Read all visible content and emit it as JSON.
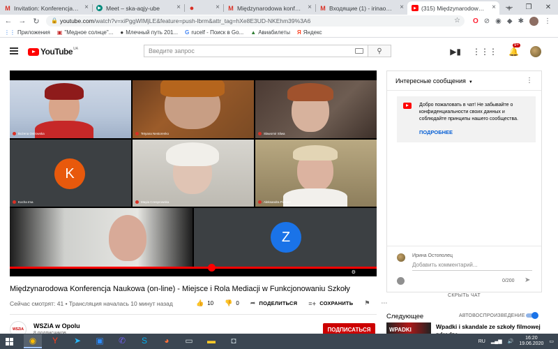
{
  "browser": {
    "tabs": [
      {
        "icon": "gmail-icon",
        "title": "Invitation: Konferencja @ Fri Jun",
        "active": false
      },
      {
        "icon": "meet-icon",
        "title": "Meet – ska-aqjy-ube",
        "active": false
      },
      {
        "icon": "recording-icon",
        "title": "",
        "active": false
      },
      {
        "icon": "gmail-icon",
        "title": "Międzynarodowa konferencja M...",
        "active": false
      },
      {
        "icon": "gmail-icon",
        "title": "Входящие (1) - irinaostopolets@...",
        "active": false
      },
      {
        "icon": "youtube-icon",
        "title": "(315) Międzynarodowa Konf...",
        "active": true
      }
    ],
    "url_host": "youtube.com",
    "url_rest": "/watch?v=xiPggWIMjLE&feature=push-lbrm&attr_tag=hXe8E3UD-NKEhm39%3A6",
    "bookmarks": [
      {
        "icon": "apps-icon",
        "label": "Приложения"
      },
      {
        "icon": "bookmark-icon",
        "label": "\"Медное солнце\"..."
      },
      {
        "icon": "bookmark-icon",
        "label": "Млечный путь 201..."
      },
      {
        "icon": "google-icon",
        "label": "rucelf - Поиск в Go..."
      },
      {
        "icon": "bookmark-icon",
        "label": "Авиабилеты"
      },
      {
        "icon": "yandex-icon",
        "label": "Яндекс"
      }
    ]
  },
  "youtube": {
    "logo_text": "YouTube",
    "logo_region": "UA",
    "search_placeholder": "Введите запрос",
    "notification_badge": "9+"
  },
  "video": {
    "participants": [
      {
        "name": "Bożena Ostrowska"
      },
      {
        "name": "Tetyana Nestorenko"
      },
      {
        "name": "Slawomir Sliwa"
      },
      {
        "name": "Kocha Ima",
        "initial": "K"
      },
      {
        "name": "Mayia Czesprowska"
      },
      {
        "name": "Aleksandra Piekarz"
      },
      {
        "name": ""
      },
      {
        "name": "",
        "initial": "Z"
      }
    ],
    "progress": 0.55,
    "title": "Międzynarodowa Konferencja Naukowa (on-line) - Miejsce i Rola Mediacji w Funkcjonowaniu Szkoły",
    "meta": "Сейчас смотрят: 41 • Трансляция началась 10 минут назад",
    "likes": "10",
    "dislikes": "0",
    "share_label": "ПОДЕЛИТЬСЯ",
    "save_label": "СОХРАНИТЬ"
  },
  "channel": {
    "avatar_text": "WSZiA",
    "name": "WSZiA w Opolu",
    "subs": "8 подписчиков",
    "subscribe_label": "ПОДПИСАТЬСЯ"
  },
  "chat": {
    "header": "Интересные сообщения",
    "welcome_text": "Добро пожаловать в чат! Не забывайте о конфиденциальности своих данных и соблюдайте принципы нашего сообщества.",
    "more_link": "ПОДРОБНЕЕ",
    "user_name": "Ирина Остополец",
    "input_placeholder": "Добавить комментарий...",
    "char_count": "0/200",
    "hide_label": "СКРЫТЬ ЧАТ"
  },
  "sidebar": {
    "next_label": "Следующее",
    "autoplay_label": "АВТОВОСПРОИЗВЕДЕНИЕ",
    "autoplay_on": true,
    "next_video": {
      "thumb_text": "WPADKI",
      "title": "Wpadki i skandale ze szkoły filmowej zdradze..."
    }
  },
  "taskbar": {
    "apps": [
      "chrome-icon",
      "yandex-browser-icon",
      "telegram-icon",
      "zoom-icon",
      "viber-icon",
      "skype-icon",
      "firefox-icon",
      "explorer-icon",
      "folder-icon",
      "media-icon"
    ],
    "language": "RU",
    "time": "16:20",
    "date": "19.06.2020"
  },
  "colors": {
    "youtube_red": "#ff0000",
    "subscribe_red": "#cc0000",
    "link_blue": "#065fd4",
    "taskbar": "#3b4652"
  }
}
